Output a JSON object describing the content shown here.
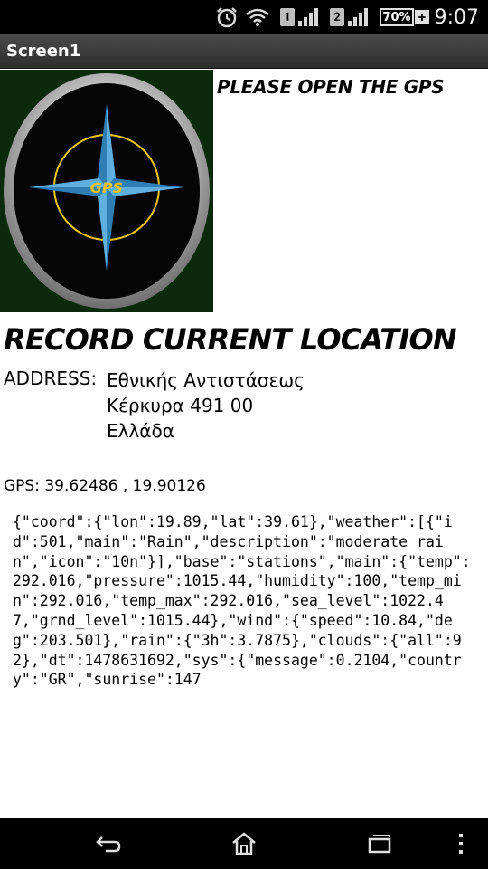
{
  "status_bar": {
    "time": "9:07",
    "sim1": "1",
    "sim2": "2",
    "battery": "70%",
    "battery_plus": "+",
    "icons": [
      "alarm-icon",
      "wifi-icon",
      "signal-icon",
      "battery-icon"
    ]
  },
  "app": {
    "title": "Screen1"
  },
  "main": {
    "gps_image_label": "GPS",
    "open_gps_text": "PLEASE OPEN THE GPS",
    "record_title": "RECORD CURRENT LOCATION",
    "address_label": "ADDRESS:",
    "address_line1": "Εθνικής Αντιστάσεως",
    "address_line2": "Κέρκυρα 491 00",
    "address_line3": "Ελλάδα",
    "gps_text": "GPS: 39.62486 , 19.90126",
    "weather_json": "{\"coord\":{\"lon\":19.89,\"lat\":39.61},\"weather\":[{\"id\":501,\"main\":\"Rain\",\"description\":\"moderate rain\",\"icon\":\"10n\"}],\"base\":\"stations\",\"main\":{\"temp\":292.016,\"pressure\":1015.44,\"humidity\":100,\"temp_min\":292.016,\"temp_max\":292.016,\"sea_level\":1022.47,\"grnd_level\":1015.44},\"wind\":{\"speed\":10.84,\"deg\":203.501},\"rain\":{\"3h\":3.7875},\"clouds\":{\"all\":92},\"dt\":1478631692,\"sys\":{\"message\":0.2104,\"country\":\"GR\",\"sunrise\":147"
  },
  "colors": {
    "status_bg": "#000000",
    "title_bg": "#3a3a3a",
    "compass_blue": "#4a9fd4",
    "compass_yellow": "#e8e81a",
    "compass_label": "#f0c419"
  },
  "nav_bar": {
    "icons": [
      "back-icon",
      "home-icon",
      "recent-apps-icon",
      "overflow-menu-icon"
    ]
  }
}
